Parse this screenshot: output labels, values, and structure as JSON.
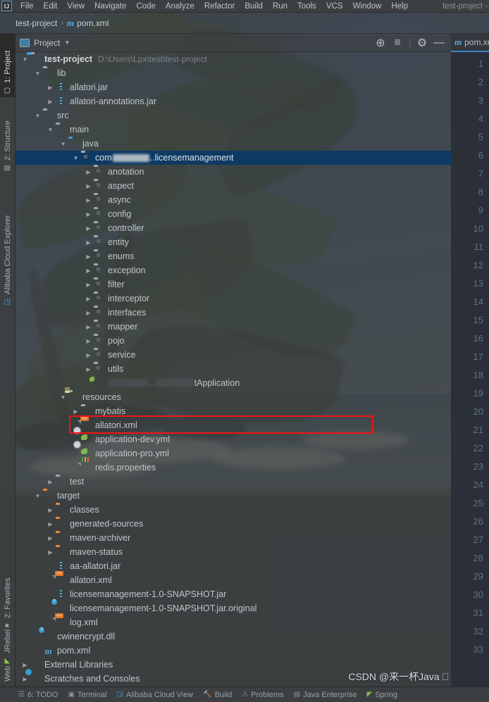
{
  "window": {
    "title": "test-project -"
  },
  "menubar": {
    "logo_icon": "intellij-logo-icon",
    "items": [
      {
        "label": "File"
      },
      {
        "label": "Edit"
      },
      {
        "label": "View"
      },
      {
        "label": "Navigate"
      },
      {
        "label": "Code"
      },
      {
        "label": "Analyze"
      },
      {
        "label": "Refactor"
      },
      {
        "label": "Build"
      },
      {
        "label": "Run"
      },
      {
        "label": "Tools"
      },
      {
        "label": "VCS"
      },
      {
        "label": "Window"
      },
      {
        "label": "Help"
      }
    ]
  },
  "navbar": {
    "project": "test-project",
    "separator": "›",
    "file": "pom.xml",
    "file_icon": "maven-m-icon"
  },
  "left_strip": {
    "top_tabs": [
      {
        "label": "1: Project",
        "icon": "project-folder-icon",
        "active": true
      },
      {
        "label": "2: Structure",
        "icon": "structure-icon",
        "active": false
      },
      {
        "label": "Alibaba Cloud Explorer",
        "icon": "alibaba-cloud-icon",
        "active": false
      }
    ],
    "bottom_tabs": [
      {
        "label": "2: Favorites",
        "icon": "star-icon"
      },
      {
        "label": "JRebel",
        "icon": "jrebel-icon"
      },
      {
        "label": "Web",
        "icon": "web-globe-icon"
      }
    ]
  },
  "tool_window": {
    "title": "Project",
    "caret_icon": "chevron-down-icon",
    "actions": [
      {
        "name": "locate-icon",
        "glyph": "⊕"
      },
      {
        "name": "collapse-all-icon",
        "glyph": "≡"
      },
      {
        "name": "gear-icon",
        "glyph": "⚙"
      },
      {
        "name": "minimize-icon",
        "glyph": "—"
      }
    ]
  },
  "tree": {
    "rows": [
      {
        "depth": 0,
        "arrow": "down",
        "icon": "module-folder-icon",
        "label": "test-project",
        "bold": true,
        "path": "D:\\Users\\Lpx\\test\\test-project"
      },
      {
        "depth": 1,
        "arrow": "down",
        "icon": "folder-icon",
        "label": "lib"
      },
      {
        "depth": 2,
        "arrow": "right",
        "icon": "jar-icon",
        "label": "allatori.jar"
      },
      {
        "depth": 2,
        "arrow": "right",
        "icon": "jar-icon",
        "label": "allatori-annotations.jar"
      },
      {
        "depth": 1,
        "arrow": "down",
        "icon": "folder-icon",
        "label": "src"
      },
      {
        "depth": 2,
        "arrow": "down",
        "icon": "folder-icon",
        "label": "main"
      },
      {
        "depth": 3,
        "arrow": "down",
        "icon": "source-folder-icon",
        "label": "java"
      },
      {
        "depth": 4,
        "arrow": "down",
        "icon": "package-icon",
        "label": "com",
        "redacted": true,
        "label_suffix": "..licensemanagement",
        "selected": true
      },
      {
        "depth": 5,
        "arrow": "right",
        "icon": "package-icon",
        "label": "anotation"
      },
      {
        "depth": 5,
        "arrow": "right",
        "icon": "package-icon",
        "label": "aspect"
      },
      {
        "depth": 5,
        "arrow": "right",
        "icon": "package-icon",
        "label": "async"
      },
      {
        "depth": 5,
        "arrow": "right",
        "icon": "package-icon",
        "label": "config"
      },
      {
        "depth": 5,
        "arrow": "right",
        "icon": "package-icon",
        "label": "controller"
      },
      {
        "depth": 5,
        "arrow": "right",
        "icon": "package-icon",
        "label": "entity"
      },
      {
        "depth": 5,
        "arrow": "right",
        "icon": "package-icon",
        "label": "enums"
      },
      {
        "depth": 5,
        "arrow": "right",
        "icon": "package-icon",
        "label": "exception"
      },
      {
        "depth": 5,
        "arrow": "right",
        "icon": "package-icon",
        "label": "filter"
      },
      {
        "depth": 5,
        "arrow": "right",
        "icon": "package-icon",
        "label": "interceptor"
      },
      {
        "depth": 5,
        "arrow": "right",
        "icon": "package-icon",
        "label": "interfaces"
      },
      {
        "depth": 5,
        "arrow": "right",
        "icon": "package-icon",
        "label": "mapper"
      },
      {
        "depth": 5,
        "arrow": "right",
        "icon": "package-icon",
        "label": "pojo"
      },
      {
        "depth": 5,
        "arrow": "right",
        "icon": "package-icon",
        "label": "service"
      },
      {
        "depth": 5,
        "arrow": "right",
        "icon": "package-icon",
        "label": "utils"
      },
      {
        "depth": 5,
        "arrow": "none",
        "icon": "spring-boot-class-icon",
        "label": "",
        "redacted_class": true,
        "label_suffix": "tApplication"
      },
      {
        "depth": 3,
        "arrow": "down",
        "icon": "resources-folder-icon",
        "label": "resources"
      },
      {
        "depth": 4,
        "arrow": "right",
        "icon": "folder-icon",
        "label": "mybatis"
      },
      {
        "depth": 4,
        "arrow": "none",
        "icon": "xml-file-icon",
        "label": "allatori.xml",
        "highlighted": true
      },
      {
        "depth": 4,
        "arrow": "none",
        "icon": "yml-file-icon",
        "label": "application-dev.yml"
      },
      {
        "depth": 4,
        "arrow": "none",
        "icon": "yml-file-icon",
        "label": "application-pro.yml"
      },
      {
        "depth": 4,
        "arrow": "none",
        "icon": "properties-file-icon",
        "label": "redis.properties"
      },
      {
        "depth": 2,
        "arrow": "right",
        "icon": "folder-icon",
        "label": "test"
      },
      {
        "depth": 1,
        "arrow": "down",
        "icon": "excluded-folder-icon",
        "label": "target"
      },
      {
        "depth": 2,
        "arrow": "right",
        "icon": "excluded-folder-icon",
        "label": "classes"
      },
      {
        "depth": 2,
        "arrow": "right",
        "icon": "excluded-folder-icon",
        "label": "generated-sources"
      },
      {
        "depth": 2,
        "arrow": "right",
        "icon": "excluded-folder-icon",
        "label": "maven-archiver"
      },
      {
        "depth": 2,
        "arrow": "right",
        "icon": "excluded-folder-icon",
        "label": "maven-status"
      },
      {
        "depth": 2,
        "arrow": "none",
        "icon": "jar-icon",
        "label": "aa-allatori.jar"
      },
      {
        "depth": 2,
        "arrow": "none",
        "icon": "xml-file-icon",
        "label": "allatori.xml"
      },
      {
        "depth": 2,
        "arrow": "none",
        "icon": "jar-icon",
        "label": "licensemanagement-1.0-SNAPSHOT.jar"
      },
      {
        "depth": 2,
        "arrow": "none",
        "icon": "unknown-file-icon",
        "label": "licensemanagement-1.0-SNAPSHOT.jar.original"
      },
      {
        "depth": 2,
        "arrow": "none",
        "icon": "xml-file-icon",
        "label": "log.xml"
      },
      {
        "depth": 1,
        "arrow": "none",
        "icon": "unknown-file-icon",
        "label": "cwinencrypt.dll"
      },
      {
        "depth": 1,
        "arrow": "none",
        "icon": "maven-m-icon",
        "label": "pom.xml"
      },
      {
        "depth": 0,
        "arrow": "right",
        "icon": "external-libraries-icon",
        "label": "External Libraries"
      },
      {
        "depth": 0,
        "arrow": "right",
        "icon": "scratches-icon",
        "label": "Scratches and Consoles"
      }
    ]
  },
  "editor": {
    "tab": {
      "label": "pom.xml",
      "icon": "maven-m-icon"
    },
    "line_numbers": [
      1,
      2,
      3,
      4,
      5,
      6,
      7,
      8,
      9,
      10,
      11,
      12,
      13,
      14,
      15,
      16,
      17,
      18,
      19,
      20,
      21,
      22,
      23,
      24,
      25,
      26,
      27,
      28,
      29,
      30,
      31,
      32,
      33
    ]
  },
  "annotation": {
    "color": "#f21414",
    "target": "allatori.xml"
  },
  "watermark": {
    "text": "CSDN @来一杯Java ⎕"
  },
  "statusbar": {
    "items": [
      {
        "label": "6: TODO",
        "icon": "todo-list-icon"
      },
      {
        "label": "Terminal",
        "icon": "terminal-icon"
      },
      {
        "label": "Alibaba Cloud View",
        "icon": "alibaba-cloud-icon"
      },
      {
        "label": "Build",
        "icon": "build-hammer-icon"
      },
      {
        "label": "Problems",
        "icon": "problems-warning-icon"
      },
      {
        "label": "Java Enterprise",
        "icon": "java-enterprise-icon"
      },
      {
        "label": "Spring",
        "icon": "spring-leaf-icon"
      }
    ]
  },
  "colors": {
    "accent_blue": "#3e87c4",
    "selection_blue": "#0d3a63",
    "annotation_red": "#f21414",
    "excluded_orange": "#e08a3c",
    "panel_bg": "#3c3f41"
  }
}
